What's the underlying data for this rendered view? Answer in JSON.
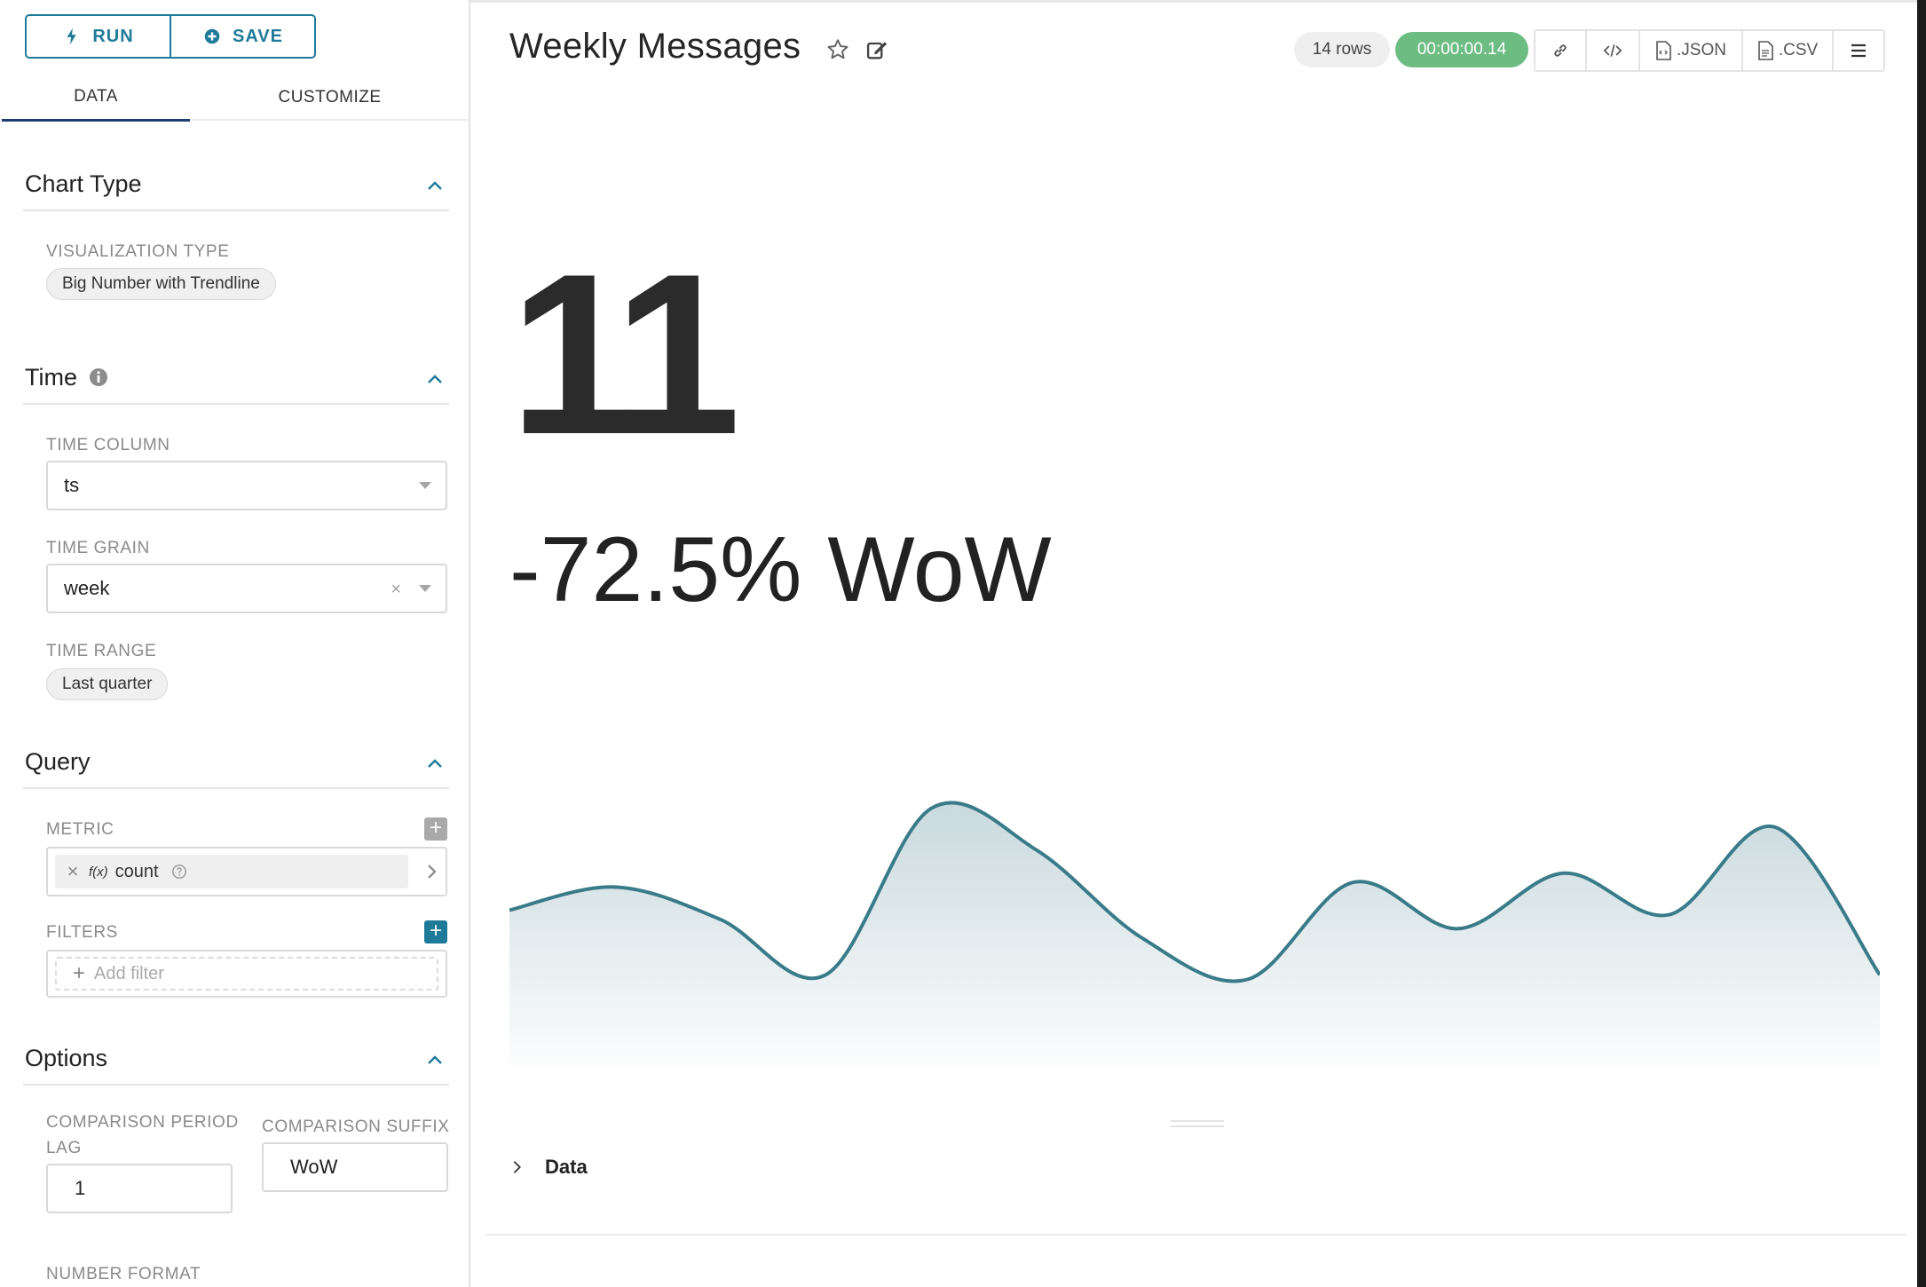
{
  "toolbar": {
    "run_label": "RUN",
    "save_label": "SAVE"
  },
  "tabs": {
    "data": "DATA",
    "customize": "CUSTOMIZE"
  },
  "sections": {
    "chart_type": {
      "title": "Chart Type",
      "viz_label": "VISUALIZATION TYPE",
      "viz_value": "Big Number with Trendline"
    },
    "time": {
      "title": "Time",
      "time_column_label": "TIME COLUMN",
      "time_column_value": "ts",
      "time_grain_label": "TIME GRAIN",
      "time_grain_value": "week",
      "time_range_label": "TIME RANGE",
      "time_range_value": "Last quarter"
    },
    "query": {
      "title": "Query",
      "metric_label": "METRIC",
      "metric_fx": "f(x)",
      "metric_value": "count",
      "filters_label": "FILTERS",
      "add_filter": "Add filter"
    },
    "options": {
      "title": "Options",
      "lag_label_line1": "COMPARISON PERIOD",
      "lag_label_line2": "LAG",
      "lag_value": "1",
      "suffix_label": "COMPARISON SUFFIX",
      "suffix_value": "WoW",
      "number_format_label": "NUMBER FORMAT"
    }
  },
  "header": {
    "title": "Weekly Messages",
    "rows_badge": "14 rows",
    "duration_badge": "00:00:00.14",
    "json_label": ".JSON",
    "csv_label": ".CSV"
  },
  "big_number": {
    "value": "11",
    "subheader": "-72.5% WoW"
  },
  "data_panel": {
    "label": "Data"
  },
  "colors": {
    "accent": "#1f7a99",
    "trend_line": "#3a7b8a",
    "trend_fill": "#c9d9de",
    "success": "#6dbd82",
    "nav_active": "#1d3f74"
  },
  "chart_data": {
    "type": "area",
    "x": [
      1,
      2,
      3,
      4,
      5,
      6,
      7,
      8,
      9,
      10,
      11,
      12,
      13,
      14
    ],
    "values": [
      21,
      23.5,
      20,
      14,
      32,
      27.5,
      18,
      13.5,
      24,
      19,
      25,
      20.5,
      30,
      14
    ]
  }
}
